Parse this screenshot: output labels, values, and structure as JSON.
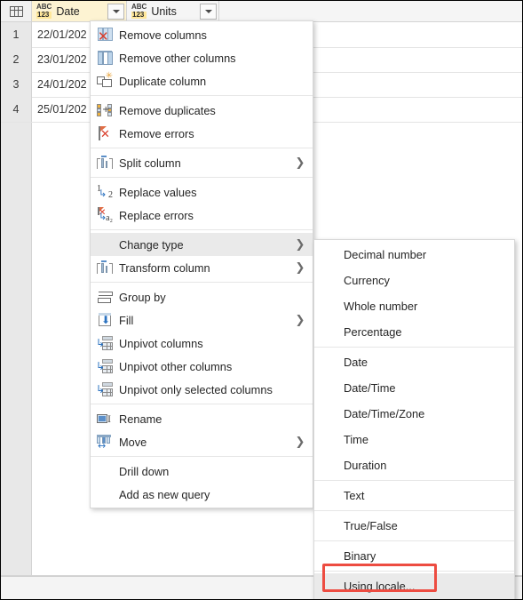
{
  "grid": {
    "corner_icon": "select-all-table-icon",
    "columns": [
      {
        "name": "Date",
        "type_icon": "abc123-any-icon",
        "abc": "ABC",
        "num": "123",
        "filter_icon": "filter-caret-icon"
      },
      {
        "name": "Units",
        "type_icon": "abc123-any-icon",
        "abc": "ABC",
        "num": "123",
        "filter_icon": "filter-caret-icon"
      }
    ],
    "rows": [
      {
        "num": "1",
        "date": "22/01/202",
        "units": ""
      },
      {
        "num": "2",
        "date": "23/01/202",
        "units": ""
      },
      {
        "num": "3",
        "date": "24/01/202",
        "units": ""
      },
      {
        "num": "4",
        "date": "25/01/202",
        "units": ""
      }
    ]
  },
  "context_menu": {
    "name": "column-context-menu",
    "items": [
      {
        "label": "Remove columns",
        "icon": "remove-columns-icon",
        "submenu": false,
        "separator_after": false
      },
      {
        "label": "Remove other columns",
        "icon": "remove-other-columns-icon",
        "submenu": false,
        "separator_after": false
      },
      {
        "label": "Duplicate column",
        "icon": "duplicate-column-icon",
        "submenu": false,
        "separator_after": true
      },
      {
        "label": "Remove duplicates",
        "icon": "remove-duplicates-icon",
        "submenu": false,
        "separator_after": false
      },
      {
        "label": "Remove errors",
        "icon": "remove-errors-icon",
        "submenu": false,
        "separator_after": true
      },
      {
        "label": "Split column",
        "icon": "split-column-icon",
        "submenu": true,
        "separator_after": true
      },
      {
        "label": "Replace values",
        "icon": "replace-values-icon",
        "submenu": false,
        "separator_after": false
      },
      {
        "label": "Replace errors",
        "icon": "replace-errors-icon",
        "submenu": false,
        "separator_after": true
      },
      {
        "label": "Change type",
        "icon": "none",
        "submenu": true,
        "separator_after": false,
        "selected": true
      },
      {
        "label": "Transform column",
        "icon": "transform-column-icon",
        "submenu": true,
        "separator_after": true
      },
      {
        "label": "Group by",
        "icon": "group-by-icon",
        "submenu": false,
        "separator_after": false
      },
      {
        "label": "Fill",
        "icon": "fill-icon",
        "submenu": true,
        "separator_after": false
      },
      {
        "label": "Unpivot columns",
        "icon": "unpivot-columns-icon",
        "submenu": false,
        "separator_after": false
      },
      {
        "label": "Unpivot other columns",
        "icon": "unpivot-other-columns-icon",
        "submenu": false,
        "separator_after": false
      },
      {
        "label": "Unpivot only selected columns",
        "icon": "unpivot-only-selected-columns-icon",
        "submenu": false,
        "separator_after": true
      },
      {
        "label": "Rename",
        "icon": "rename-icon",
        "submenu": false,
        "separator_after": false
      },
      {
        "label": "Move",
        "icon": "move-icon",
        "submenu": true,
        "separator_after": true
      },
      {
        "label": "Drill down",
        "icon": "none",
        "submenu": false,
        "separator_after": false
      },
      {
        "label": "Add as new query",
        "icon": "none",
        "submenu": false,
        "separator_after": false
      }
    ]
  },
  "submenu": {
    "name": "change-type-submenu",
    "items": [
      {
        "label": "Decimal number",
        "separator_after": false
      },
      {
        "label": "Currency",
        "separator_after": false
      },
      {
        "label": "Whole number",
        "separator_after": false
      },
      {
        "label": "Percentage",
        "separator_after": true
      },
      {
        "label": "Date",
        "separator_after": false
      },
      {
        "label": "Date/Time",
        "separator_after": false
      },
      {
        "label": "Date/Time/Zone",
        "separator_after": false
      },
      {
        "label": "Time",
        "separator_after": false
      },
      {
        "label": "Duration",
        "separator_after": true
      },
      {
        "label": "Text",
        "separator_after": true
      },
      {
        "label": "True/False",
        "separator_after": true
      },
      {
        "label": "Binary",
        "separator_after": true
      },
      {
        "label": "Using locale...",
        "separator_after": false,
        "highlighted": true,
        "annotated": true
      }
    ]
  },
  "annotation": {
    "name": "using-locale-highlight-box",
    "color": "#ed4c41",
    "target_label": "Using locale..."
  }
}
